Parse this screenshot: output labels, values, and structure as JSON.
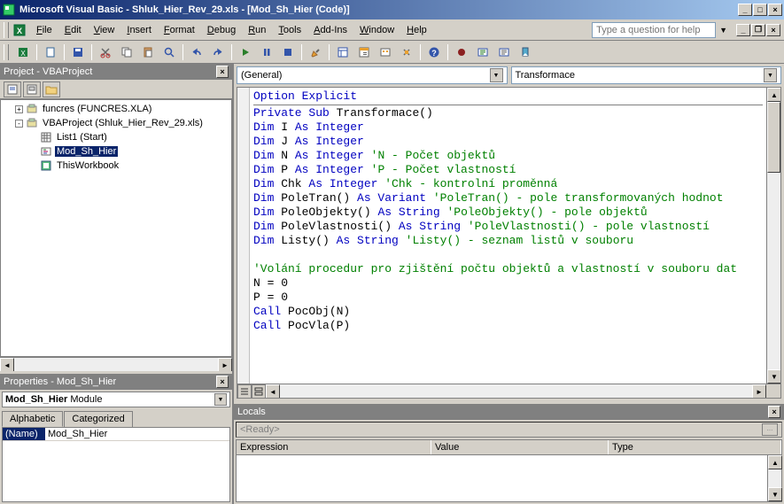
{
  "title": "Microsoft Visual Basic - Shluk_Hier_Rev_29.xls - [Mod_Sh_Hier (Code)]",
  "menus": [
    "File",
    "Edit",
    "View",
    "Insert",
    "Format",
    "Debug",
    "Run",
    "Tools",
    "Add-Ins",
    "Window",
    "Help"
  ],
  "help_placeholder": "Type a question for help",
  "project": {
    "title": "Project - VBAProject",
    "items": [
      {
        "label": "funcres (FUNCRES.XLA)",
        "type": "project",
        "toggle": "+"
      },
      {
        "label": "VBAProject (Shluk_Hier_Rev_29.xls)",
        "type": "project",
        "toggle": "-"
      },
      {
        "label": "List1 (Start)",
        "type": "sheet"
      },
      {
        "label": "Mod_Sh_Hier",
        "type": "module",
        "selected": true
      },
      {
        "label": "ThisWorkbook",
        "type": "workbook"
      }
    ]
  },
  "properties": {
    "title": "Properties - Mod_Sh_Hier",
    "dd_name": "Mod_Sh_Hier",
    "dd_type": "Module",
    "tabs": [
      "Alphabetic",
      "Categorized"
    ],
    "rows": [
      {
        "name": "(Name)",
        "value": "Mod_Sh_Hier"
      }
    ]
  },
  "code": {
    "dd_left": "(General)",
    "dd_right": "Transformace",
    "lines": [
      [
        [
          "kw",
          "Option Explicit"
        ]
      ],
      "-",
      [
        [
          "kw",
          "Private Sub"
        ],
        "",
        " Transformace()"
      ],
      [
        [
          "kw",
          "Dim"
        ],
        "",
        " I ",
        [
          "kw",
          "As Integer"
        ]
      ],
      [
        [
          "kw",
          "Dim"
        ],
        "",
        " J ",
        [
          "kw",
          "As Integer"
        ]
      ],
      [
        [
          "kw",
          "Dim"
        ],
        "",
        " N ",
        [
          "kw",
          "As Integer"
        ],
        " ",
        [
          "cm",
          "'N - Počet objektů"
        ]
      ],
      [
        [
          "kw",
          "Dim"
        ],
        "",
        " P ",
        [
          "kw",
          "As Integer"
        ],
        " ",
        [
          "cm",
          "'P - Počet vlastností"
        ]
      ],
      [
        [
          "kw",
          "Dim"
        ],
        "",
        " Chk ",
        [
          "kw",
          "As Integer"
        ],
        " ",
        [
          "cm",
          "'Chk - kontrolní proměnná"
        ]
      ],
      [
        [
          "kw",
          "Dim"
        ],
        "",
        " PoleTran() ",
        [
          "kw",
          "As Variant"
        ],
        " ",
        [
          "cm",
          "'PoleTran() - pole transformovaných hodnot"
        ]
      ],
      [
        [
          "kw",
          "Dim"
        ],
        "",
        " PoleObjekty() ",
        [
          "kw",
          "As String"
        ],
        " ",
        [
          "cm",
          "'PoleObjekty() - pole objektů"
        ]
      ],
      [
        [
          "kw",
          "Dim"
        ],
        "",
        " PoleVlastnosti() ",
        [
          "kw",
          "As String"
        ],
        " ",
        [
          "cm",
          "'PoleVlastnosti() - pole vlastností"
        ]
      ],
      [
        [
          "kw",
          "Dim"
        ],
        "",
        " Listy() ",
        [
          "kw",
          "As String"
        ],
        " ",
        [
          "cm",
          "'Listy() - seznam listů v souboru"
        ]
      ],
      [],
      [
        [
          "cm",
          "'Volání procedur pro zjištění počtu objektů a vlastností v souboru dat"
        ]
      ],
      [
        "",
        "N = 0"
      ],
      [
        "",
        "P = 0"
      ],
      [
        [
          "kw",
          "Call"
        ],
        "",
        " PocObj(N)"
      ],
      [
        [
          "kw",
          "Call"
        ],
        "",
        " PocVla(P)"
      ]
    ]
  },
  "locals": {
    "title": "Locals",
    "ready": "<Ready>",
    "cols": [
      "Expression",
      "Value",
      "Type"
    ]
  }
}
